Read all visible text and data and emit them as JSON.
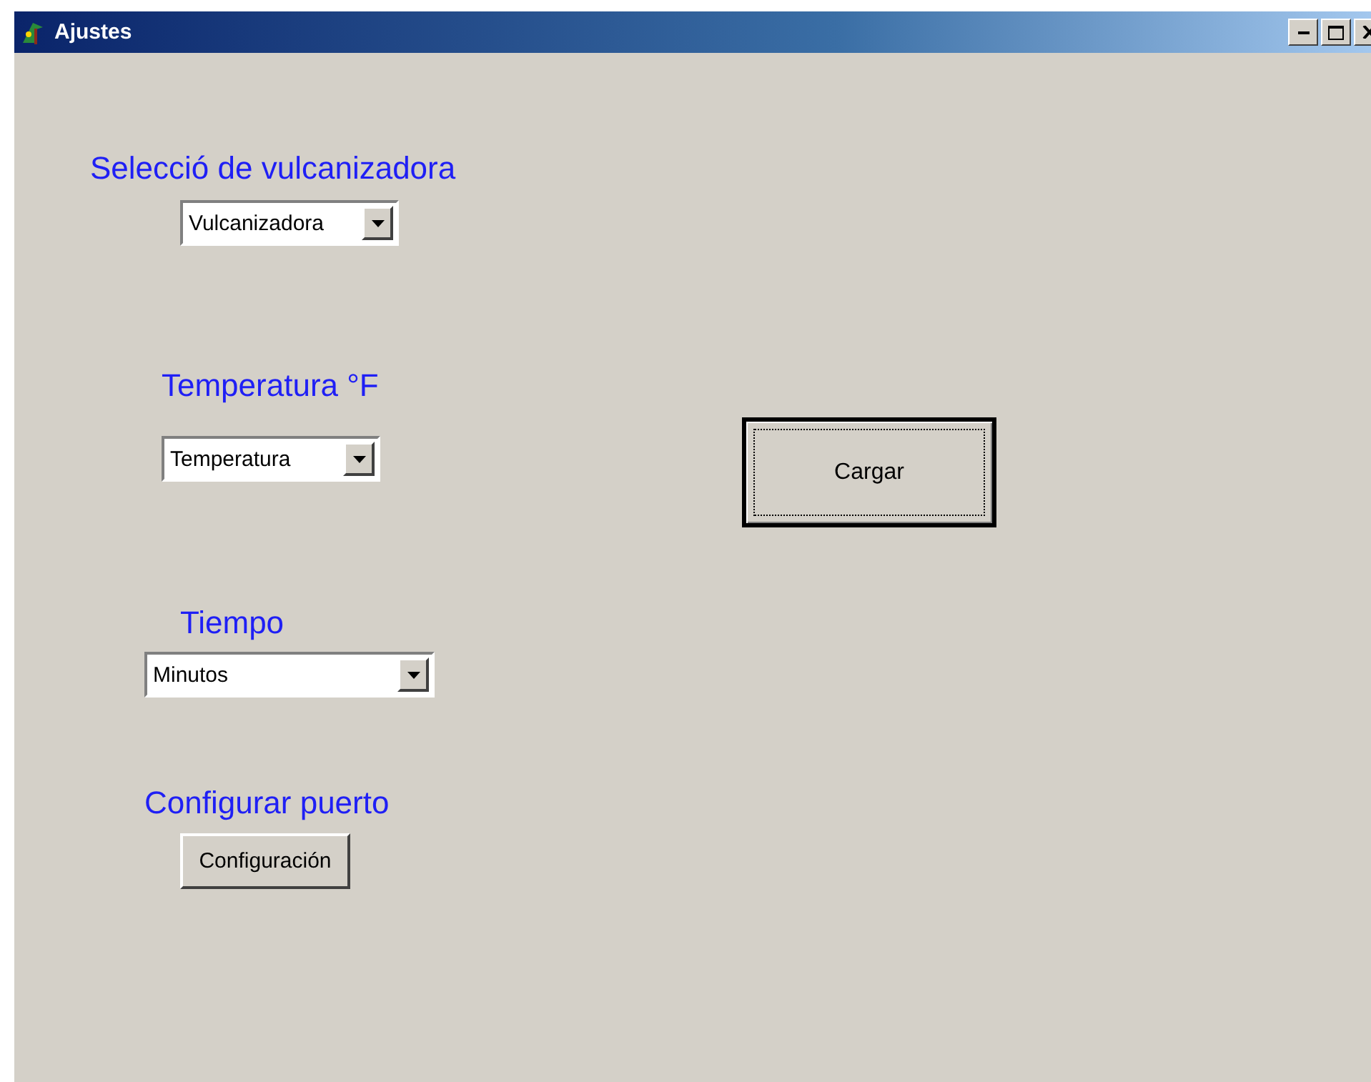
{
  "window": {
    "title": "Ajustes"
  },
  "settings": [
    {
      "kind": "dropdown",
      "label": "Selecció de vulcanizadora",
      "value": "Vulcanizadora"
    },
    {
      "kind": "dropdown",
      "label": "Temperatura °F",
      "value": "Temperatura"
    },
    {
      "kind": "dropdown",
      "label": "Tiempo",
      "value": "Minutos"
    },
    {
      "kind": "button",
      "label": "Configurar puerto",
      "button": "Configuración"
    }
  ],
  "load_button": {
    "label": "Cargar",
    "focused": true
  }
}
